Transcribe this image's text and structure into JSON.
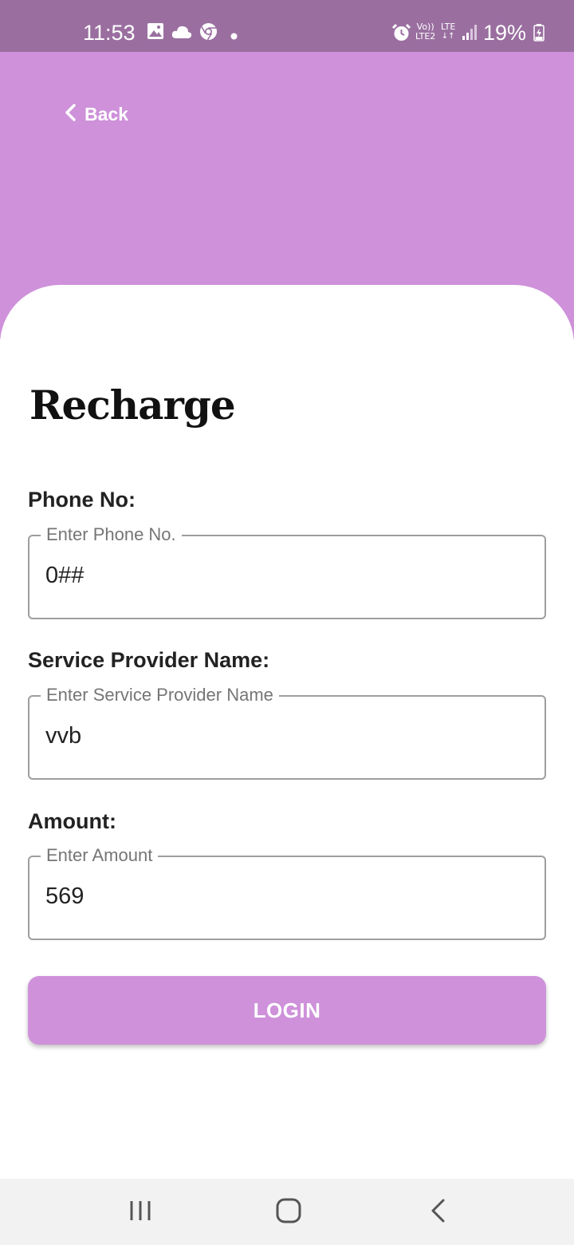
{
  "status_bar": {
    "time": "11:53",
    "lte2_top": "Vo))",
    "lte2_bottom": "LTE2",
    "lte_label": "LTE",
    "battery": "19%",
    "icons": [
      "gallery-icon",
      "cloud-icon",
      "chrome-icon",
      "dot-icon",
      "alarm-icon",
      "signal-icon",
      "battery-icon"
    ]
  },
  "header": {
    "back_label": "Back",
    "background_color": "#ce91da"
  },
  "page": {
    "title": "Recharge"
  },
  "form": {
    "phone": {
      "label": "Phone No:",
      "placeholder": "Enter Phone No.",
      "value": "0##"
    },
    "provider": {
      "label": "Service Provider Name:",
      "placeholder": "Enter Service Provider Name",
      "value": "vvb"
    },
    "amount": {
      "label": "Amount:",
      "placeholder": "Enter Amount",
      "value": "569"
    },
    "submit_label": "LOGIN"
  },
  "colors": {
    "status_bar": "#9a6fa0",
    "accent": "#ce91da",
    "border": "#9e9e9e"
  }
}
